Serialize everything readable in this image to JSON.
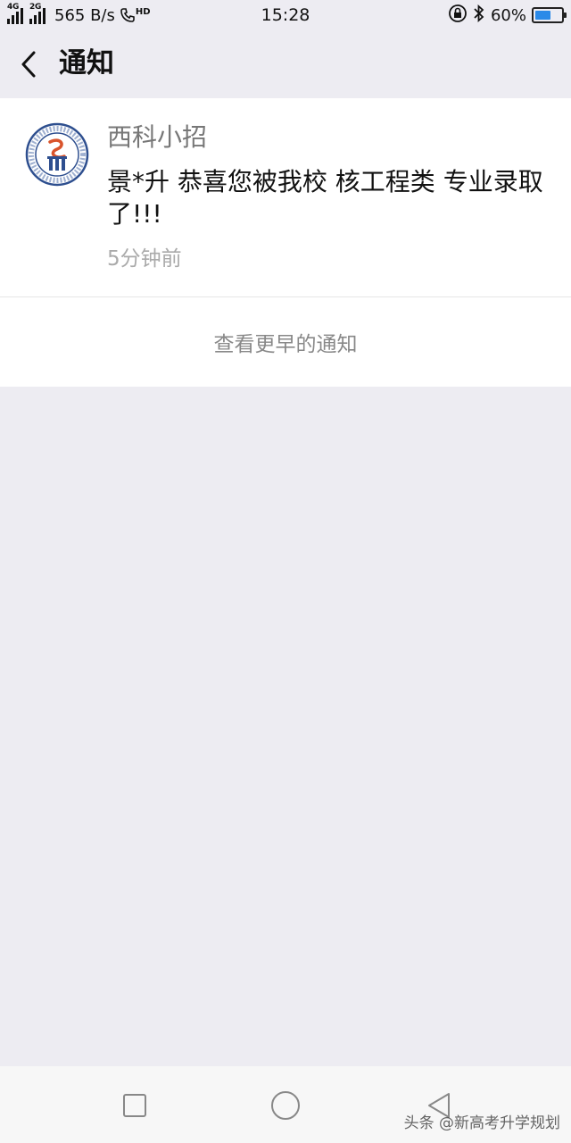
{
  "status_bar": {
    "net1": "4G",
    "net2": "2G",
    "speed": "565 B/s",
    "hd": "HD",
    "time": "15:28",
    "battery_text": "60%",
    "battery_level": 0.6
  },
  "header": {
    "title": "通知",
    "back_icon": "chevron-left-icon"
  },
  "notification": {
    "sender": "西科小招",
    "message": "景*升 恭喜您被我校 核工程类 专业录取了!!!",
    "time": "5分钟前"
  },
  "more": {
    "label": "查看更早的通知"
  },
  "nav": {
    "recents_icon": "square-icon",
    "home_icon": "circle-icon",
    "back_icon": "triangle-back-icon"
  },
  "watermark": "头条 @新高考升学规划",
  "colors": {
    "background": "#edecf2",
    "card": "#ffffff",
    "battery_fill": "#2b8ae8"
  }
}
